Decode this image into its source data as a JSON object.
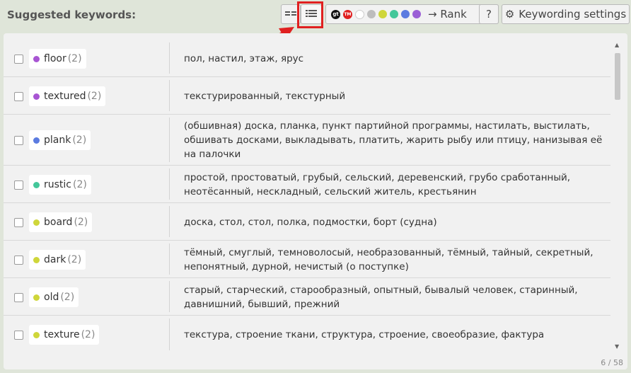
{
  "header": {
    "title": "Suggested keywords:",
    "rank_label": "→ Rank",
    "help_label": "?",
    "settings_label": "Keywording settings",
    "rank_sources": [
      "gt",
      "TM"
    ],
    "color_dots": [
      "#ffffff",
      "#bdbdbd",
      "#cfd63a",
      "#44c79a",
      "#5b7be0",
      "#9b5fd6"
    ]
  },
  "keywords": [
    {
      "word": "floor",
      "count": "(2)",
      "color": "#a855d3",
      "translation": "пол, настил, этаж, ярус"
    },
    {
      "word": "textured",
      "count": "(2)",
      "color": "#a855d3",
      "translation": "текстурированный, текстурный"
    },
    {
      "word": "plank",
      "count": "(2)",
      "color": "#5b7be0",
      "translation": "(обшивная) доска, планка, пункт партийной программы, настилать, выстилать, обшивать досками, выкладывать, платить, жарить рыбу или птицу, нанизывая её на палочки"
    },
    {
      "word": "rustic",
      "count": "(2)",
      "color": "#44c79a",
      "translation": "простой, простоватый, грубый, сельский, деревенский, грубо сработанный, неотёсанный, нескладный, сельский житель, крестьянин"
    },
    {
      "word": "board",
      "count": "(2)",
      "color": "#cfd63a",
      "translation": "доска, стол, стол, полка, подмостки, борт (судна)"
    },
    {
      "word": "dark",
      "count": "(2)",
      "color": "#cfd63a",
      "translation": "тёмный, смуглый, темноволосый, необразованный, тёмный, тайный, секретный, непонятный, дурной, нечистый (о поступке)"
    },
    {
      "word": "old",
      "count": "(2)",
      "color": "#cfd63a",
      "translation": "старый, старческий, старообразный, опытный, бывалый человек, старинный, давнишний, бывший, прежний"
    },
    {
      "word": "texture",
      "count": "(2)",
      "color": "#cfd63a",
      "translation": "текстура, строение ткани, структура, строение, своеобразие, фактура"
    }
  ],
  "pager": "6 / 58"
}
